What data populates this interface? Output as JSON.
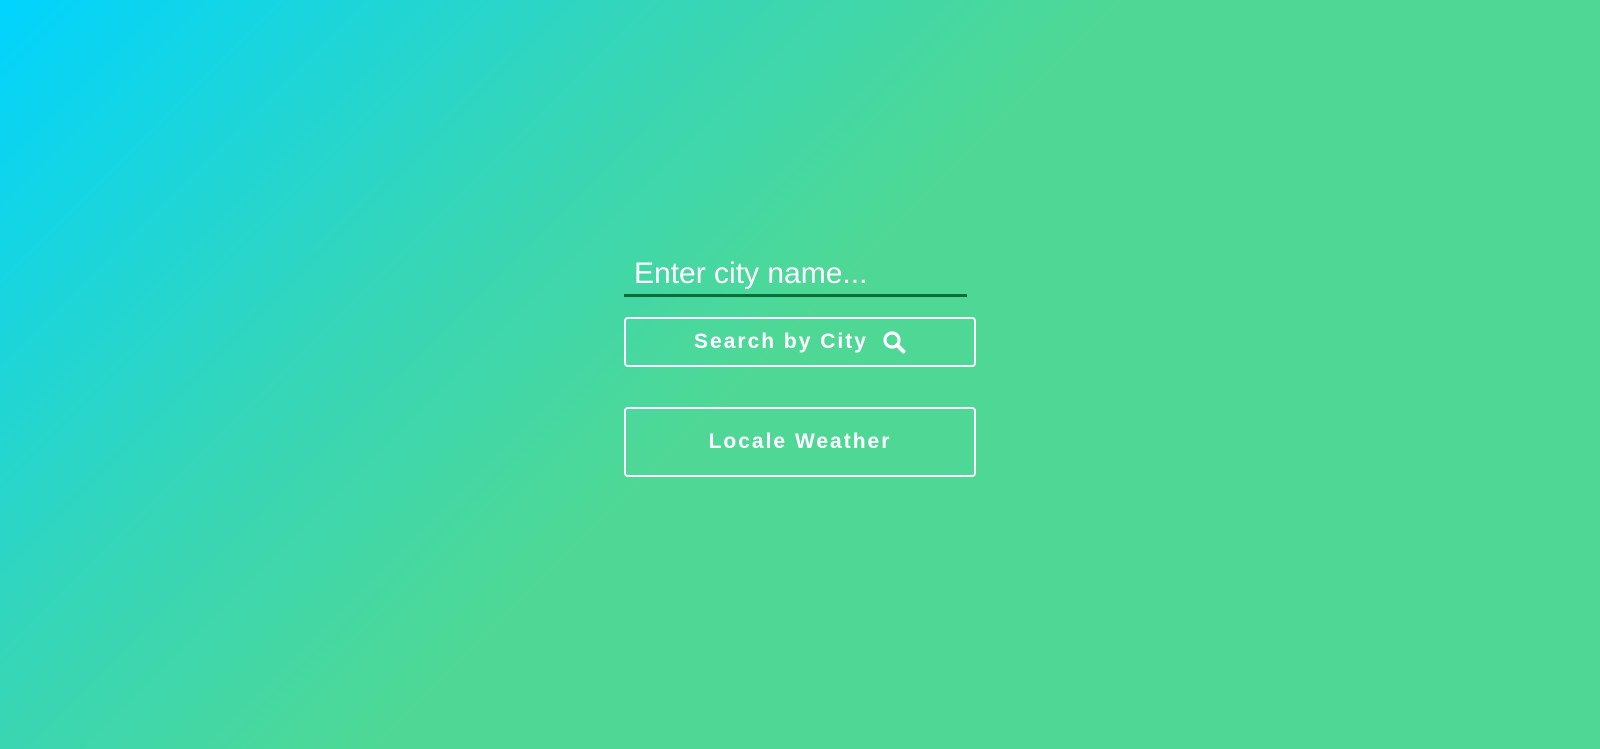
{
  "search": {
    "placeholder": "Enter city name...",
    "value": ""
  },
  "buttons": {
    "search_label": "Search by City",
    "search_icon": "magnifying-glass-icon",
    "locale_label": "Locale Weather"
  },
  "colors": {
    "gradient_start": "#00d4ff",
    "gradient_end": "#4fd895",
    "input_underline": "#0f6b3a",
    "text": "#ffffff"
  }
}
